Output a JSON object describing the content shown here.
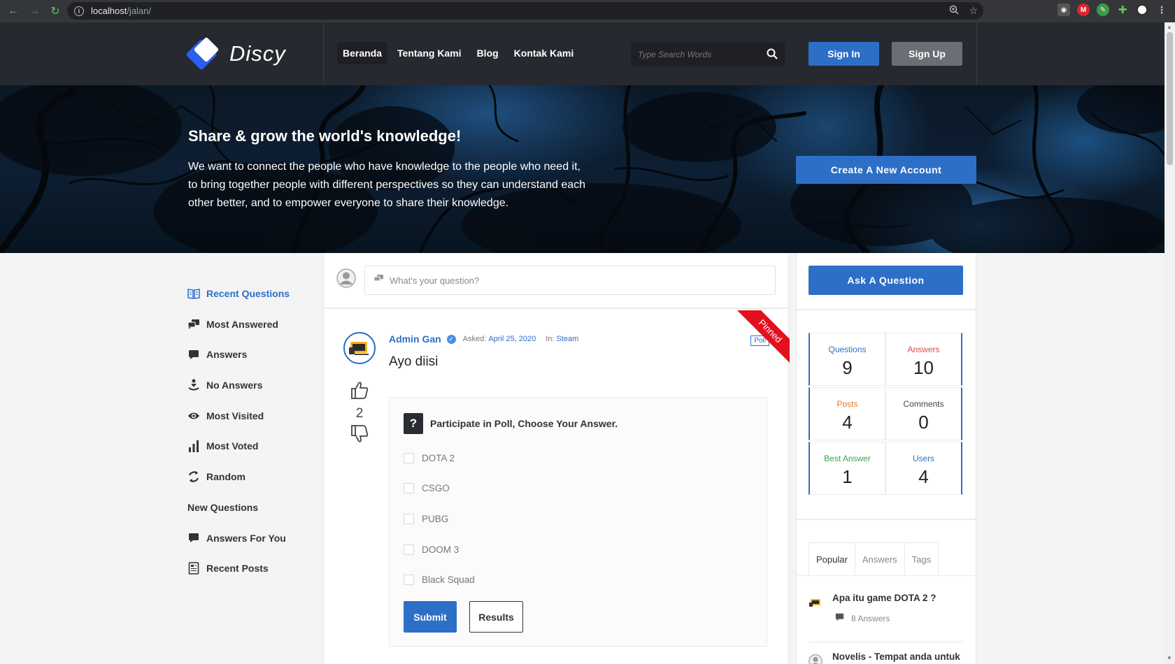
{
  "browser": {
    "url_host": "localhost",
    "url_path": "/jalan/"
  },
  "header": {
    "logo_text": "Discy",
    "nav": [
      {
        "label": "Beranda"
      },
      {
        "label": "Tentang Kami"
      },
      {
        "label": "Blog"
      },
      {
        "label": "Kontak Kami"
      }
    ],
    "search_placeholder": "Type Search Words",
    "signin_label": "Sign In",
    "signup_label": "Sign Up"
  },
  "hero": {
    "title": "Share & grow the world's knowledge!",
    "text": "We want to connect the people who have knowledge to the people who need it, to bring together people with different perspectives so they can understand each other better, and to empower everyone to share their knowledge.",
    "create_label": "Create A New Account"
  },
  "left_nav": [
    {
      "label": "Recent Questions",
      "icon": "book-icon"
    },
    {
      "label": "Most Answered",
      "icon": "chat-bubbles-icon"
    },
    {
      "label": "Answers",
      "icon": "comment-icon"
    },
    {
      "label": "No Answers",
      "icon": "person-down-icon"
    },
    {
      "label": "Most Visited",
      "icon": "eye-icon"
    },
    {
      "label": "Most Voted",
      "icon": "bar-chart-icon"
    },
    {
      "label": "Random",
      "icon": "refresh-icon"
    },
    {
      "label": "New Questions",
      "icon": ""
    },
    {
      "label": "Answers For You",
      "icon": "comment-icon"
    },
    {
      "label": "Recent Posts",
      "icon": "document-icon"
    }
  ],
  "ask": {
    "placeholder": "What's your question?"
  },
  "question": {
    "author": "Admin Gan",
    "asked_label": "Asked:",
    "asked_date": "April 25, 2020",
    "in_label": "In:",
    "category": "Steam",
    "title": "Ayo diisi",
    "votes": "2",
    "pinned_label": "Pinned",
    "poll_tag": "Poll",
    "poll": {
      "heading": "Participate in Poll, Choose Your Answer.",
      "options": [
        "DOTA 2",
        "CSGO",
        "PUBG",
        "DOOM 3",
        "Black Squad"
      ],
      "submit_label": "Submit",
      "results_label": "Results"
    }
  },
  "right": {
    "ask_label": "Ask A Question",
    "stats": [
      {
        "label": "Questions",
        "value": "9",
        "color": "#2d6fc7"
      },
      {
        "label": "Answers",
        "value": "10",
        "color": "#e04848"
      },
      {
        "label": "Posts",
        "value": "4",
        "color": "#e07a2d"
      },
      {
        "label": "Comments",
        "value": "0",
        "color": "#444444"
      },
      {
        "label": "Best Answer",
        "value": "1",
        "color": "#3aa35a"
      },
      {
        "label": "Users",
        "value": "4",
        "color": "#2d6fc7"
      }
    ],
    "tabs": [
      "Popular",
      "Answers",
      "Tags"
    ],
    "posts": [
      {
        "title": "Apa itu game DOTA 2 ?",
        "meta": "8 Answers"
      },
      {
        "title": "Novelis - Tempat anda untuk",
        "meta": ""
      }
    ]
  },
  "colors": {
    "accent": "#2d6fc7",
    "header_bg": "#272930",
    "ribbon": "#e3101f"
  }
}
